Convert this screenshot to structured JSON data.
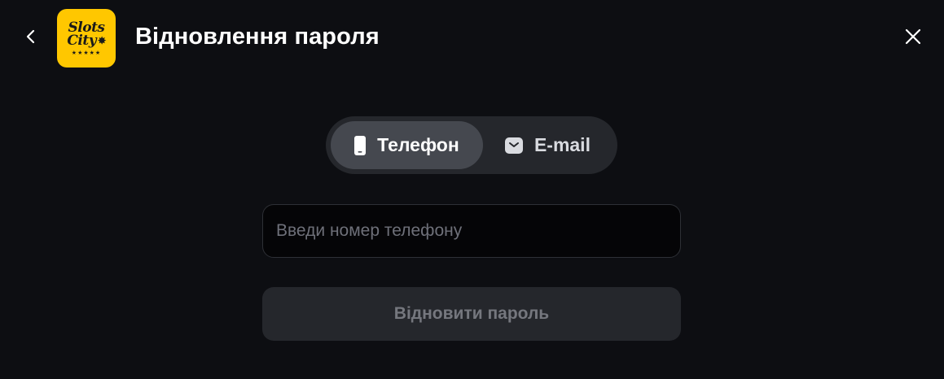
{
  "header": {
    "title": "Відновлення пароля",
    "back_icon": "chevron-left-icon",
    "close_icon": "close-icon",
    "logo": {
      "line1": "Slots",
      "line2": "City",
      "stars": "★★★★★",
      "color": "#ffc700"
    }
  },
  "tabs": [
    {
      "label": "Телефон",
      "icon": "phone-icon",
      "active": true
    },
    {
      "label": "E-mail",
      "icon": "mail-icon",
      "active": false
    }
  ],
  "form": {
    "phone_placeholder": "Введи номер телефону",
    "phone_value": "",
    "submit_label": "Відновити пароль"
  },
  "colors": {
    "background": "#0d0e12",
    "tab_bar": "#25272c",
    "active_tab": "#45484f",
    "accent": "#ffc700"
  }
}
